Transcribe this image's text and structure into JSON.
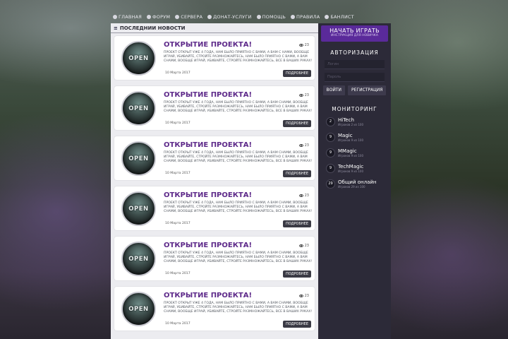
{
  "nav": [
    {
      "icon": "home-icon",
      "label": "Главная"
    },
    {
      "icon": "forum-icon",
      "label": "Форум"
    },
    {
      "icon": "servers-icon",
      "label": "Сервера"
    },
    {
      "icon": "donate-icon",
      "label": "Донат-услуги"
    },
    {
      "icon": "help-icon",
      "label": "Помощь"
    },
    {
      "icon": "rules-icon",
      "label": "Правила"
    },
    {
      "icon": "banlist-icon",
      "label": "Банлист"
    }
  ],
  "news_header": "Последнии новости",
  "news": [
    {
      "title": "Открытие проекта!",
      "thumb": "OPEN",
      "views": "23",
      "date": "10 Марта 2017",
      "more": "Подробнее",
      "text": "Проект открыт уже 4 года, нам было приятно с вами, а вам с нами, вообще играй, убивайте, стройте размножайтесь, нам было приятно с вами, а вам снами, вообще играй, убивайте, стройте размножайтесь, все в ваших руках!"
    },
    {
      "title": "Открытие проекта!",
      "thumb": "OPEN",
      "views": "23",
      "date": "10 Марта 2017",
      "more": "Подробнее",
      "text": "Проект открыт уже 4 года, нам было приятно с вами, а вам снами, вообще играй, убивайте, стройте размножайтесь, нам было приятно с вами, а вам снами, вообще играй, убивайте, стройте размножайтесь, все в ваших руках!"
    },
    {
      "title": "Открытие проекта!",
      "thumb": "OPEN",
      "views": "23",
      "date": "10 Марта 2017",
      "more": "Подробнее",
      "text": "Проект открыт уже 4 года, нам было приятно с вами, а вам снами, вообще играй, убивайте, стройте размножайтесь, нам было приятно с вами, а вам снами, вообще играй, убивайте, стройте размножайтесь, все в ваших руках!"
    },
    {
      "title": "Открытие проекта!",
      "thumb": "OPEN",
      "views": "23",
      "date": "10 Марта 2017",
      "more": "Подробнее",
      "text": "Проект открыт уже 4 года, нам было приятно с вами, а вам снами, вообще играй, убивайте, стройте размножайтесь, нам было приятно с вами, а вам снами, вообще играй, убивайте, стройте размножайтесь, все в ваших руках!"
    },
    {
      "title": "Открытие проекта!",
      "thumb": "OPEN",
      "views": "23",
      "date": "10 Марта 2017",
      "more": "Подробнее",
      "text": "Проект открыт уже 4 года, нам было приятно с вами, а вам снами, вообще играй, убивайте, стройте размножайтесь, нам было приятно с вами, а вам снами, вообще играй, убивайте, стройте размножайтесь, все в ваших руках!"
    },
    {
      "title": "Открытие проекта!",
      "thumb": "OPEN",
      "views": "23",
      "date": "10 Марта 2017",
      "more": "Подробнее",
      "text": "Проект открыт уже 4 года, нам было приятно с вами, а вам снами, вообще играй, убивайте, стройте размножайтесь, нам было приятно с вами, а вам снами, вообще играй, убивайте, стройте размножайтесь, все в ваших руках!"
    }
  ],
  "sidebar": {
    "play_title": "Начать играть",
    "play_sub": "Инструкция для новичка",
    "auth_heading": "Авторизация",
    "login_placeholder": "Логин",
    "password_placeholder": "Пароль",
    "login_button": "Войти",
    "register_button": "Регистрация",
    "monitoring_heading": "Мониторинг",
    "servers": [
      {
        "count": "2",
        "name": "HiTech",
        "sub": "Игроков 2 из 100"
      },
      {
        "count": "9",
        "name": "Magic",
        "sub": "Игроков 9 из 100"
      },
      {
        "count": "9",
        "name": "MMagic",
        "sub": "Игроков 9 из 100"
      },
      {
        "count": "9",
        "name": "TechMagic",
        "sub": "Игроков 9 из 100"
      },
      {
        "count": "29",
        "name": "Общий онлайн",
        "sub": "Игроков 29 из 100"
      }
    ]
  },
  "colors": {
    "accent": "#5a2a9a",
    "title": "#5e2a8a",
    "sidebar_bg": "#2c2a38"
  }
}
